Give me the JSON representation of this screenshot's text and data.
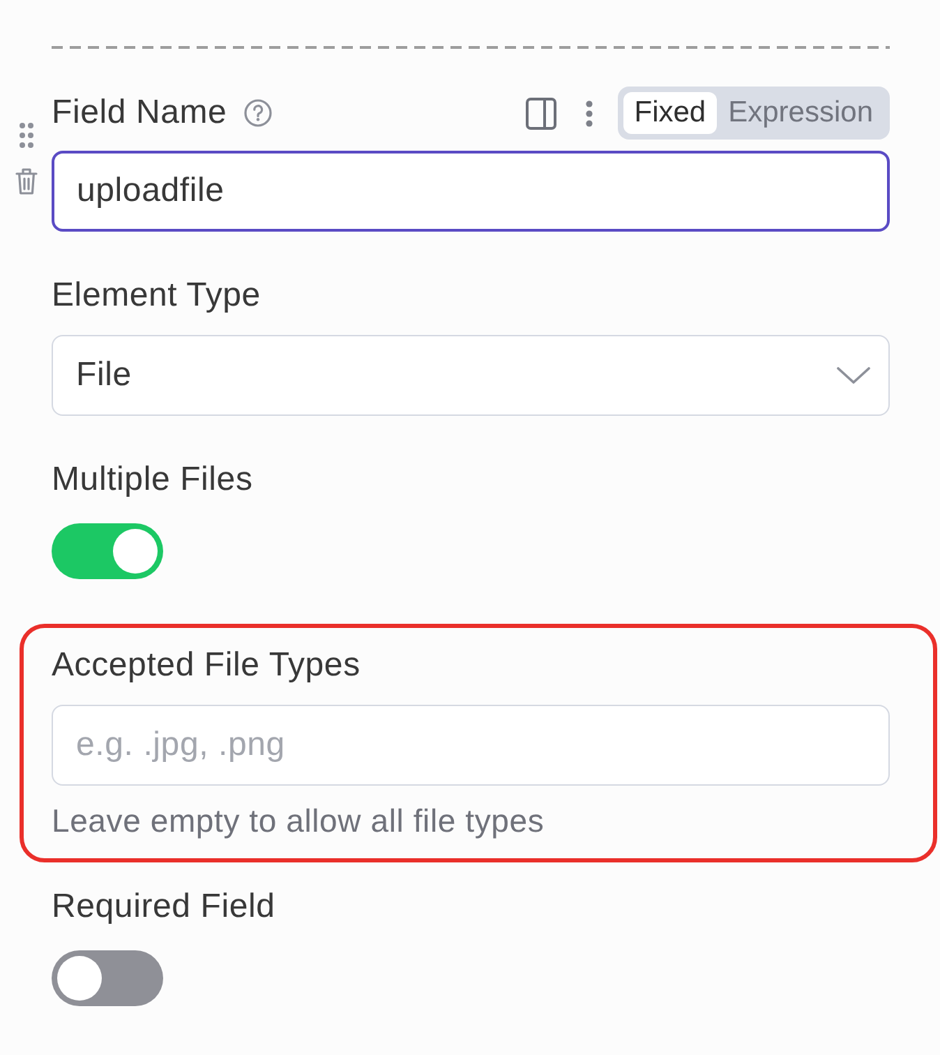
{
  "fields": [
    {
      "kind": "text",
      "label": "Field Name",
      "help": true,
      "mode_options": [
        {
          "label": "Fixed",
          "selected": true
        },
        {
          "label": "Expression",
          "selected": false
        }
      ],
      "value": "uploadfile",
      "focused": true,
      "highlighted": false
    },
    {
      "kind": "select",
      "label": "Element Type",
      "value": "File",
      "highlighted": false
    },
    {
      "kind": "switch",
      "label": "Multiple Files",
      "on": true,
      "highlighted": false
    },
    {
      "kind": "text",
      "label": "Accepted File Types",
      "placeholder": "e.g. .jpg, .png",
      "hint": "Leave empty to allow all file types",
      "focused": false,
      "highlighted": true
    },
    {
      "kind": "switch",
      "label": "Required Field",
      "on": false,
      "highlighted": false
    }
  ]
}
